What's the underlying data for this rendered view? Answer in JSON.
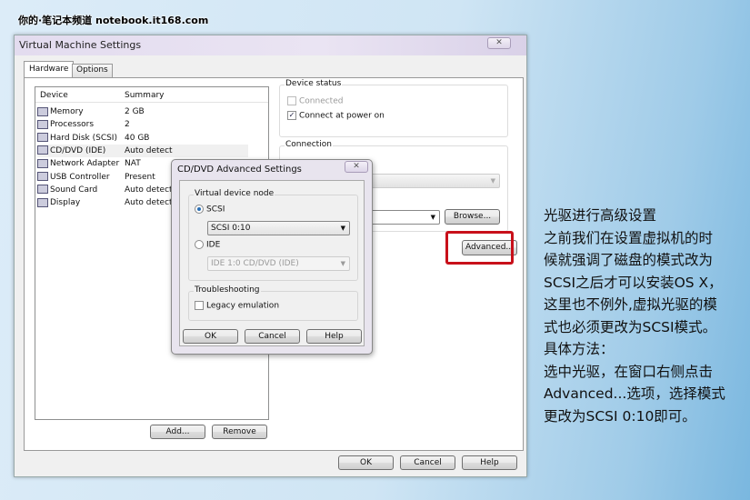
{
  "watermark": "你的·笔记本频道 notebook.it168.com",
  "window": {
    "title": "Virtual Machine Settings",
    "close_icon": "close-icon",
    "tabs": [
      {
        "label": "Hardware",
        "active": true
      },
      {
        "label": "Options",
        "active": false
      }
    ],
    "device_list": {
      "headers": [
        "Device",
        "Summary"
      ],
      "rows": [
        {
          "device": "Memory",
          "summary": "2 GB",
          "icon": "memory-icon"
        },
        {
          "device": "Processors",
          "summary": "2",
          "icon": "processor-icon"
        },
        {
          "device": "Hard Disk (SCSI)",
          "summary": "40 GB",
          "icon": "hard-disk-icon"
        },
        {
          "device": "CD/DVD (IDE)",
          "summary": "Auto detect",
          "icon": "cd-dvd-icon",
          "selected": true
        },
        {
          "device": "Network Adapter",
          "summary": "NAT",
          "icon": "network-adapter-icon"
        },
        {
          "device": "USB Controller",
          "summary": "Present",
          "icon": "usb-icon"
        },
        {
          "device": "Sound Card",
          "summary": "Auto detect",
          "icon": "sound-card-icon"
        },
        {
          "device": "Display",
          "summary": "Auto detect",
          "icon": "display-icon"
        }
      ]
    },
    "add_label": "Add...",
    "remove_label": "Remove",
    "device_status": {
      "title": "Device status",
      "connected": "Connected",
      "connect_power": "Connect at power on",
      "connect_power_checked": true
    },
    "connection": {
      "title": "Connection"
    },
    "browse_label": "Browse...",
    "advanced_label": "Advanced...",
    "ok_label": "OK",
    "cancel_label": "Cancel",
    "help_label": "Help"
  },
  "dialog": {
    "title": "CD/DVD Advanced Settings",
    "node_group": "Virtual device node",
    "scsi_label": "SCSI",
    "scsi_selected": true,
    "scsi_value": "SCSI  0:10",
    "ide_label": "IDE",
    "ide_value": "IDE  1:0  CD/DVD (IDE)",
    "troubleshooting": "Troubleshooting",
    "legacy": "Legacy emulation",
    "ok_label": "OK",
    "cancel_label": "Cancel",
    "help_label": "Help"
  },
  "highlight_color": "#c8101a",
  "note": [
    "光驱进行高级设置",
    "之前我们在设置虚拟机的时",
    "候就强调了磁盘的模式改为",
    "SCSI之后才可以安装OS X，",
    "这里也不例外,虚拟光驱的模",
    "式也必须更改为SCSI模式。",
    "具体方法：",
    "选中光驱，在窗口右侧点击",
    "Advanced...选项，选择模式",
    "更改为SCSI 0:10即可。"
  ]
}
